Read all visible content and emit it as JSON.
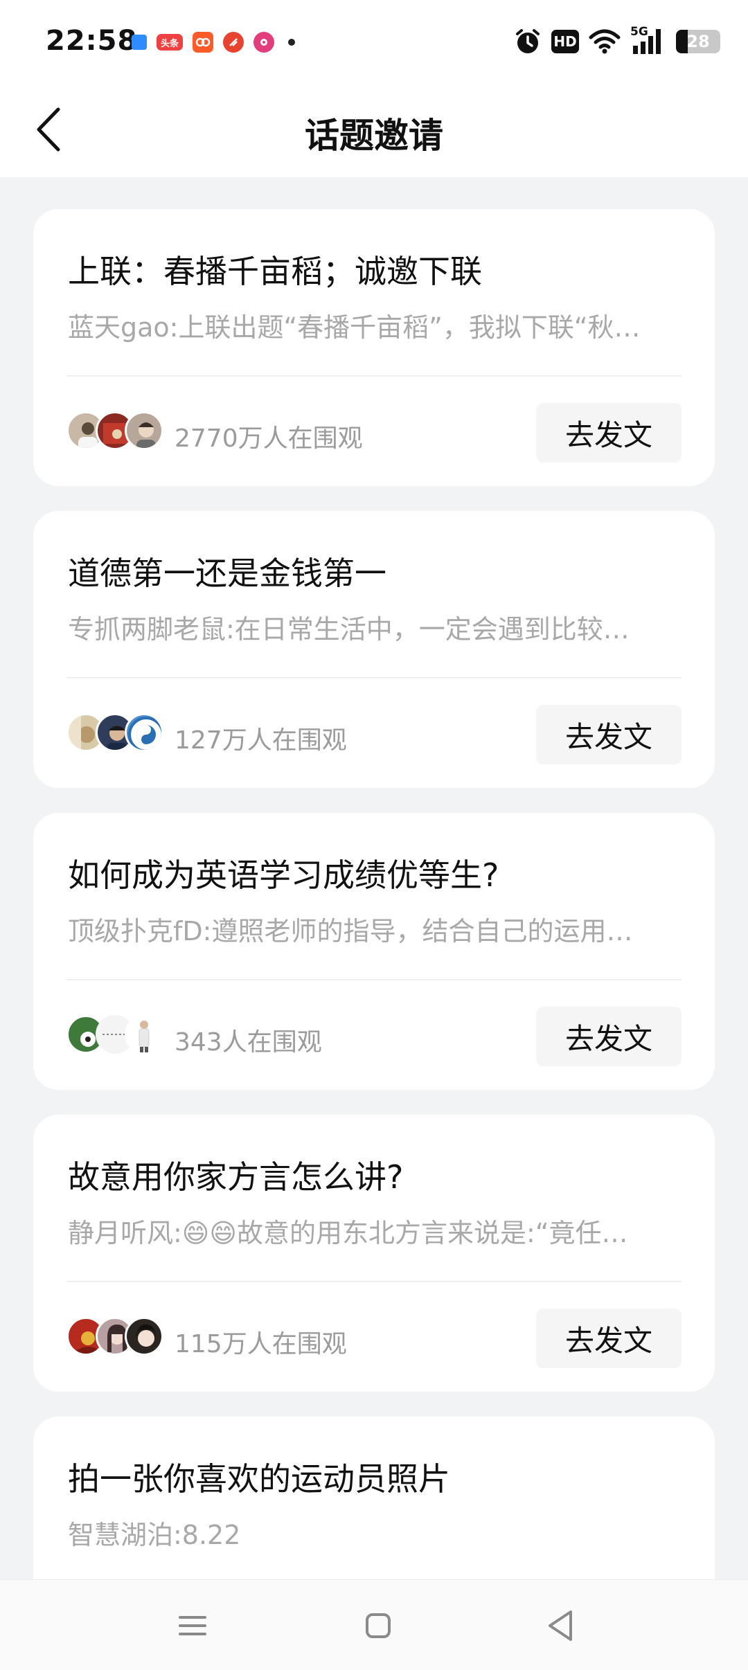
{
  "status_bar": {
    "time": "22:58",
    "apps": [
      {
        "name": "blue-app-icon",
        "label": "",
        "color": "#2f8cff"
      },
      {
        "name": "toutiao-icon",
        "label": "头条",
        "color": "#f04142"
      },
      {
        "name": "orange-app-icon",
        "label": "",
        "color": "#ff5a2a"
      },
      {
        "name": "red-app-icon",
        "label": "",
        "color": "#e8432e"
      },
      {
        "name": "pink-app-icon",
        "label": "",
        "color": "#e23d7c"
      }
    ],
    "hd_label": "HD",
    "network": "5G",
    "battery": "28"
  },
  "header": {
    "title": "话题邀请"
  },
  "topics": [
    {
      "title": "上联：春播千亩稻；诚邀下联",
      "desc": "蓝天gao:上联出题“春播千亩稻”，我拟下联“秋…",
      "viewers": "2770万人在围观",
      "button": "去发文",
      "avatars": [
        "#c9b8a6",
        "#8a2a22",
        "#b7a79a"
      ]
    },
    {
      "title": "道德第一还是金钱第一",
      "desc": "专抓两脚老鼠:在日常生活中，一定会遇到比较…",
      "viewers": "127万人在围观",
      "button": "去发文",
      "avatars": [
        "#d8c9a8",
        "#2f3d5a",
        "#4d8fcf"
      ]
    },
    {
      "title": "如何成为英语学习成绩优等生?",
      "desc": "顶级扑克fD:遵照老师的指导，结合自己的运用…",
      "viewers": "343人在围观",
      "button": "去发文",
      "avatars": [
        "#3e7a3a",
        "#f4f4f4",
        "#e6ddd6"
      ]
    },
    {
      "title": "故意用你家方言怎么讲?",
      "desc": "静月听风:😄😄故意的用东北方言来说是:“竟任…",
      "viewers": "115万人在围观",
      "button": "去发文",
      "avatars": [
        "#b62b1e",
        "#b9a0a0",
        "#2b2522"
      ]
    },
    {
      "title": "拍一张你喜欢的运动员照片",
      "desc": "智慧湖泊:8.22",
      "viewers": "",
      "button": "",
      "avatars": []
    }
  ]
}
